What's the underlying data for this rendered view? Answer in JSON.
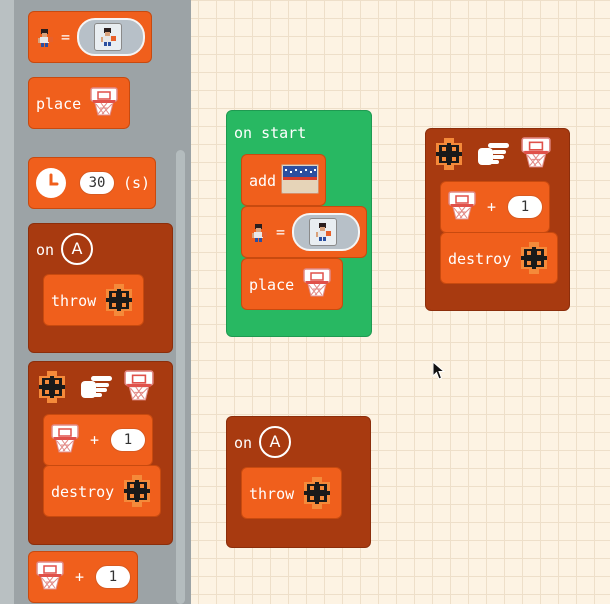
{
  "toolbox": {
    "set_block": {
      "equals": "="
    },
    "place_block": {
      "label": "place"
    },
    "timer_block": {
      "value": "30",
      "unit": "(s)"
    },
    "on_button_block": {
      "on_label": "on",
      "button": "A",
      "action_label": "throw"
    },
    "overlap_block": {
      "add_value": "1",
      "plus": "+",
      "destroy_label": "destroy"
    },
    "score_block": {
      "plus": "+",
      "value": "1"
    }
  },
  "workspace": {
    "on_start_block": {
      "label": "on start",
      "add_label": "add",
      "equals": "=",
      "place_label": "place"
    },
    "overlap_block": {
      "plus": "+",
      "value": "1",
      "destroy_label": "destroy"
    },
    "on_button_block": {
      "on_label": "on",
      "button": "A",
      "action_label": "throw"
    }
  },
  "colors": {
    "event_orange": "#f05f1c",
    "container_dark": "#a83a10",
    "start_green": "#28b862",
    "workspace_bg": "#fdf3e3",
    "toolbox_bg": "#9ca3a6"
  },
  "icons": [
    "player-sprite-icon",
    "hoop-icon",
    "ball-icon",
    "clock-icon",
    "hand-pointing-icon",
    "court-backdrop-icon",
    "mouse-cursor-icon"
  ]
}
